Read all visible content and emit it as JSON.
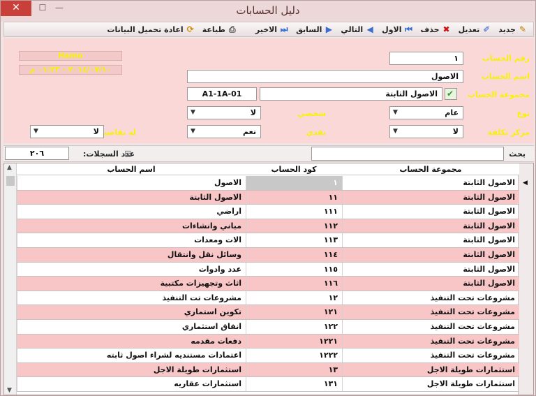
{
  "window": {
    "title": "دليل الحسابات",
    "close": "✕",
    "maximize": "☐",
    "minimize": "—"
  },
  "toolbar": {
    "new": "جديد",
    "edit": "تعديل",
    "delete": "حذف",
    "first": "الاول",
    "next": "التالي",
    "prev": "السابق",
    "last": "الاخير",
    "print": "طباعة",
    "reload": "اعادة تحميل البيانات"
  },
  "form": {
    "account_number_label": "رقم الحساب",
    "account_number": "١",
    "account_name_label": "اسم الحساب",
    "account_name": "الاصول",
    "account_group_label": "مجموعة الحساب",
    "account_group": "الاصول الثابتة",
    "account_code": "A1-1A-01",
    "type_label": "نوع",
    "type_value": "عام",
    "personal_label": "شخصي",
    "personal_value": "لا",
    "cost_center_label": "مركز تكلفة",
    "cost_center_value": "لا",
    "cash_label": "نقدي",
    "cash_value": "نعم",
    "has_details_label": "له تفاصيل",
    "has_details_value": "لا",
    "status_user": "Hamo",
    "status_datetime": "٢٠١٤/٠٧/١٠ - ٠١:٢٣ م"
  },
  "search": {
    "label": "بحث",
    "value": "",
    "records_label": "عدد السجلات:",
    "records_count": "٢٠٦"
  },
  "table": {
    "headers": {
      "group": "مجموعة الحساب",
      "code": "كود الحساب",
      "name": "اسم الحساب"
    },
    "rows": [
      {
        "group": "الاصول الثابتة",
        "code": "١",
        "name": "الاصول"
      },
      {
        "group": "الاصول الثابتة",
        "code": "١١",
        "name": "الاصول الثابتة"
      },
      {
        "group": "الاصول الثابتة",
        "code": "١١١",
        "name": "اراضي"
      },
      {
        "group": "الاصول الثابتة",
        "code": "١١٢",
        "name": "مباني وانشاءات"
      },
      {
        "group": "الاصول الثابتة",
        "code": "١١٣",
        "name": "الات ومعدات"
      },
      {
        "group": "الاصول الثابتة",
        "code": "١١٤",
        "name": "وسائل نقل وانتقال"
      },
      {
        "group": "الاصول الثابتة",
        "code": "١١٥",
        "name": "عدد وادوات"
      },
      {
        "group": "الاصول الثابتة",
        "code": "١١٦",
        "name": "اثاث وتجهيزات مكتبية"
      },
      {
        "group": "مشروعات تحت التنفيذ",
        "code": "١٢",
        "name": "مشروعات تت التنفيذ"
      },
      {
        "group": "مشروعات تحت التنفيذ",
        "code": "١٢١",
        "name": "تكوين استماري"
      },
      {
        "group": "مشروعات تحت التنفيذ",
        "code": "١٢٢",
        "name": "انفاق استثماري"
      },
      {
        "group": "مشروعات تحت التنفيذ",
        "code": "١٢٢١",
        "name": "دفعات مقدمه"
      },
      {
        "group": "مشروعات تحت التنفيذ",
        "code": "١٢٢٢",
        "name": "اعتمادات مستنديه لشراء اصول ثابته"
      },
      {
        "group": "استثمارات طويلة الاجل",
        "code": "١٣",
        "name": "استثمارات طويلة الاجل"
      },
      {
        "group": "استثمارات طويلة الاجل",
        "code": "١٣١",
        "name": "استثمارات عقاريه"
      }
    ]
  }
}
